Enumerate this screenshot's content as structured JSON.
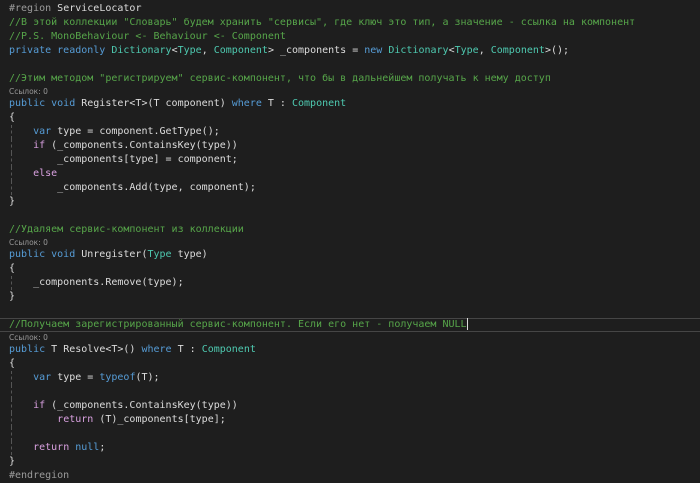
{
  "colors": {
    "background": "#1e1e1e",
    "comment": "#57a64a",
    "keyword": "#569cd6",
    "type": "#4ec9b0",
    "control": "#d8a0df"
  },
  "lines": [
    {
      "t": [
        [
          "pp",
          "#region "
        ],
        [
          "pl",
          "ServiceLocator"
        ]
      ]
    },
    {
      "t": [
        [
          "cm",
          "//В этой коллекции \"Словарь\" будем хранить \"сервисы\", где ключ это тип, а значение - ссылка на компонент"
        ]
      ]
    },
    {
      "t": [
        [
          "cm",
          "//P.S. MonoBehaviour <- Behaviour <- Component"
        ]
      ]
    },
    {
      "t": [
        [
          "kw",
          "private readonly "
        ],
        [
          "ty",
          "Dictionary"
        ],
        [
          "pl",
          "<"
        ],
        [
          "ty",
          "Type"
        ],
        [
          "pl",
          ", "
        ],
        [
          "ty",
          "Component"
        ],
        [
          "pl",
          "> _components = "
        ],
        [
          "kw",
          "new "
        ],
        [
          "ty",
          "Dictionary"
        ],
        [
          "pl",
          "<"
        ],
        [
          "ty",
          "Type"
        ],
        [
          "pl",
          ", "
        ],
        [
          "ty",
          "Component"
        ],
        [
          "pl",
          ">();"
        ]
      ]
    },
    {
      "t": []
    },
    {
      "t": [
        [
          "cm",
          "//Этим методом \"регистрируем\" сервис-компонент, что бы в дальнейшем получать к нему доступ"
        ]
      ]
    },
    {
      "lens": "Ссылок: 0"
    },
    {
      "t": [
        [
          "kw",
          "public void "
        ],
        [
          "pl",
          "Register<T>(T component) "
        ],
        [
          "kw",
          "where "
        ],
        [
          "pl",
          "T : "
        ],
        [
          "ty",
          "Component"
        ]
      ]
    },
    {
      "t": [
        [
          "pl",
          "{"
        ]
      ]
    },
    {
      "g": 1,
      "t": [
        [
          "pl",
          "    "
        ],
        [
          "kw",
          "var "
        ],
        [
          "pl",
          "type = component.GetType();"
        ]
      ]
    },
    {
      "g": 1,
      "t": [
        [
          "pl",
          "    "
        ],
        [
          "ctl",
          "if "
        ],
        [
          "pl",
          "(_components.ContainsKey(type))"
        ]
      ]
    },
    {
      "g": 1,
      "t": [
        [
          "pl",
          "        _components[type] = component;"
        ]
      ]
    },
    {
      "g": 1,
      "t": [
        [
          "pl",
          "    "
        ],
        [
          "ctl",
          "else"
        ]
      ]
    },
    {
      "g": 1,
      "t": [
        [
          "pl",
          "        _components.Add(type, component);"
        ]
      ]
    },
    {
      "t": [
        [
          "pl",
          "}"
        ]
      ]
    },
    {
      "t": []
    },
    {
      "t": [
        [
          "cm",
          "//Удаляем сервис-компонент из коллекции"
        ]
      ]
    },
    {
      "lens": "Ссылок: 0"
    },
    {
      "t": [
        [
          "kw",
          "public void "
        ],
        [
          "pl",
          "Unregister("
        ],
        [
          "ty",
          "Type "
        ],
        [
          "pl",
          "type)"
        ]
      ]
    },
    {
      "t": [
        [
          "pl",
          "{"
        ]
      ]
    },
    {
      "g": 1,
      "t": [
        [
          "pl",
          "    _components.Remove(type);"
        ]
      ]
    },
    {
      "t": [
        [
          "pl",
          "}"
        ]
      ]
    },
    {
      "t": []
    },
    {
      "cur": 1,
      "t": [
        [
          "cm",
          "//Получаем зарегистрированный сервис-компонент. Если его нет - получаем NULL"
        ]
      ]
    },
    {
      "lens": "Ссылок: 0"
    },
    {
      "t": [
        [
          "kw",
          "public "
        ],
        [
          "pl",
          "T Resolve<T>() "
        ],
        [
          "kw",
          "where "
        ],
        [
          "pl",
          "T : "
        ],
        [
          "ty",
          "Component"
        ]
      ]
    },
    {
      "t": [
        [
          "pl",
          "{"
        ]
      ]
    },
    {
      "g": 1,
      "t": [
        [
          "pl",
          "    "
        ],
        [
          "kw",
          "var "
        ],
        [
          "pl",
          "type = "
        ],
        [
          "kw",
          "typeof"
        ],
        [
          "pl",
          "(T);"
        ]
      ]
    },
    {
      "g": 1,
      "t": []
    },
    {
      "g": 1,
      "t": [
        [
          "pl",
          "    "
        ],
        [
          "ctl",
          "if "
        ],
        [
          "pl",
          "(_components.ContainsKey(type))"
        ]
      ]
    },
    {
      "g": 1,
      "t": [
        [
          "pl",
          "        "
        ],
        [
          "ctl",
          "return "
        ],
        [
          "pl",
          "(T)_components[type];"
        ]
      ]
    },
    {
      "g": 1,
      "t": []
    },
    {
      "g": 1,
      "t": [
        [
          "pl",
          "    "
        ],
        [
          "ctl",
          "return "
        ],
        [
          "kw",
          "null"
        ],
        [
          "pl",
          ";"
        ]
      ]
    },
    {
      "t": [
        [
          "pl",
          "}"
        ]
      ]
    },
    {
      "t": [
        [
          "pp",
          "#endregion"
        ]
      ]
    }
  ]
}
